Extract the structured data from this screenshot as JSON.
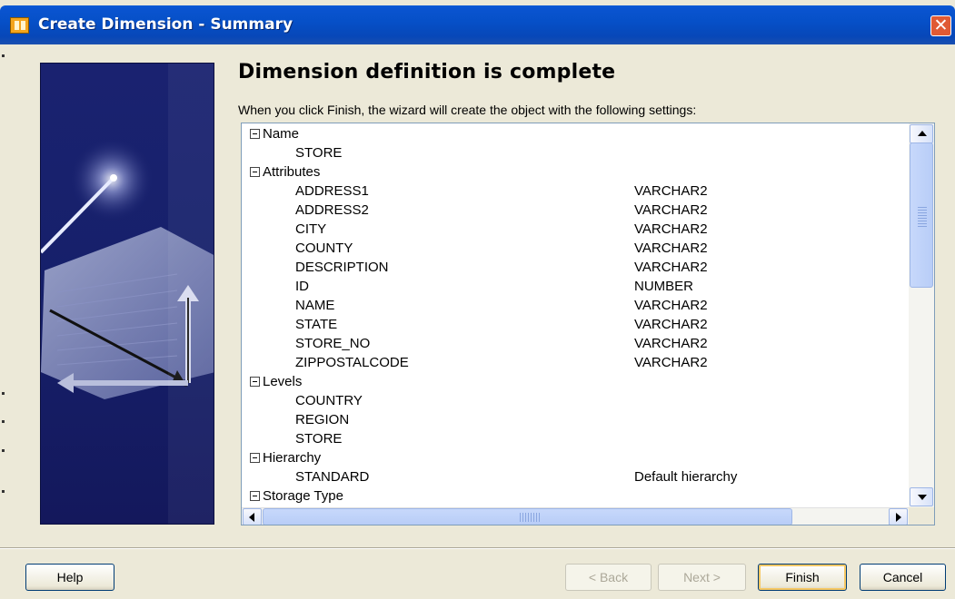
{
  "window": {
    "title": "Create Dimension - Summary",
    "close_label": "✕"
  },
  "main": {
    "heading": "Dimension definition is complete",
    "intro": "When you click Finish, the wizard will create the object with the following settings:"
  },
  "tree": {
    "rows": [
      {
        "label": "Name",
        "value": "",
        "level": 0
      },
      {
        "label": "STORE",
        "value": "",
        "level": 1
      },
      {
        "label": "Attributes",
        "value": "",
        "level": 0
      },
      {
        "label": "ADDRESS1",
        "value": "VARCHAR2",
        "level": 1
      },
      {
        "label": "ADDRESS2",
        "value": "VARCHAR2",
        "level": 1
      },
      {
        "label": "CITY",
        "value": "VARCHAR2",
        "level": 1
      },
      {
        "label": "COUNTY",
        "value": "VARCHAR2",
        "level": 1
      },
      {
        "label": "DESCRIPTION",
        "value": "VARCHAR2",
        "level": 1
      },
      {
        "label": "ID",
        "value": "NUMBER",
        "level": 1
      },
      {
        "label": "NAME",
        "value": "VARCHAR2",
        "level": 1
      },
      {
        "label": "STATE",
        "value": "VARCHAR2",
        "level": 1
      },
      {
        "label": "STORE_NO",
        "value": "VARCHAR2",
        "level": 1
      },
      {
        "label": "ZIPPOSTALCODE",
        "value": "VARCHAR2",
        "level": 1
      },
      {
        "label": "Levels",
        "value": "",
        "level": 0
      },
      {
        "label": "COUNTRY",
        "value": "",
        "level": 1
      },
      {
        "label": "REGION",
        "value": "",
        "level": 1
      },
      {
        "label": "STORE",
        "value": "",
        "level": 1
      },
      {
        "label": "Hierarchy",
        "value": "",
        "level": 0
      },
      {
        "label": "STANDARD",
        "value": "Default hierarchy",
        "level": 1
      },
      {
        "label": "Storage Type",
        "value": "",
        "level": 0
      }
    ]
  },
  "buttons": {
    "help": "Help",
    "back": "< Back",
    "next": "Next >",
    "finish": "Finish",
    "cancel": "Cancel"
  },
  "colors": {
    "titlebar": "#0a54d0",
    "art_panel": "#1a2270",
    "dialog_bg": "#ece9d8"
  }
}
